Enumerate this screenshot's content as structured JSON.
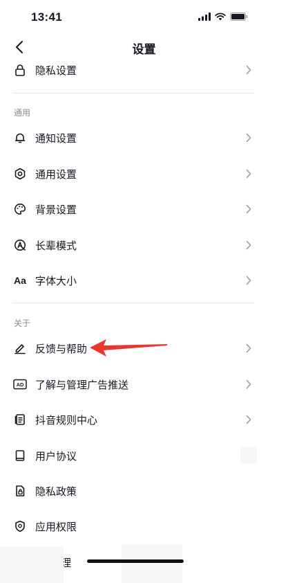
{
  "status_bar": {
    "time": "13:41"
  },
  "nav": {
    "title": "设置"
  },
  "colors": {
    "accent_arrow": "#e8372f",
    "divider": "#e8e8ea",
    "section_header": "#8a8b91"
  },
  "rows_top": [
    {
      "label": "隐私设置",
      "icon": "lock-icon"
    }
  ],
  "sections": [
    {
      "header": "通用",
      "items": [
        {
          "label": "通知设置",
          "icon": "bell-icon"
        },
        {
          "label": "通用设置",
          "icon": "gear-icon"
        },
        {
          "label": "背景设置",
          "icon": "palette-icon"
        },
        {
          "label": "长辈模式",
          "icon": "elder-mode-icon"
        },
        {
          "label": "字体大小",
          "icon": "font-size-icon",
          "icon_text": "Aa"
        }
      ]
    },
    {
      "header": "关于",
      "items": [
        {
          "label": "反馈与帮助",
          "icon": "pencil-icon"
        },
        {
          "label": "了解与管理广告推送",
          "icon": "ad-icon",
          "icon_text": "AD"
        },
        {
          "label": "抖音规则中心",
          "icon": "document-icon"
        },
        {
          "label": "用户协议",
          "icon": "book-icon"
        },
        {
          "label": "隐私政策",
          "icon": "privacy-doc-icon"
        },
        {
          "label": "应用权限",
          "icon": "location-shield-icon"
        },
        {
          "label": "理",
          "icon": "partially-hidden-icon"
        }
      ]
    }
  ]
}
